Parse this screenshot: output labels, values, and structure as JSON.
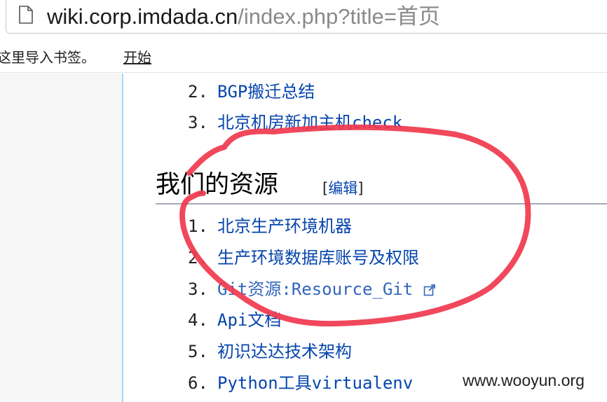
{
  "browser": {
    "url_host": "wiki.corp.imdada.cn",
    "url_path": "/index.php?title=首页",
    "page_icon": "page-icon"
  },
  "bookmarks": {
    "hint_text": "这里导入书签。",
    "start_link": "开始"
  },
  "content": {
    "prev_items": [
      {
        "num": "2.",
        "label": "BGP搬迁总结"
      },
      {
        "num": "3.",
        "label": "北京机房新加主机check"
      }
    ],
    "section": {
      "title": "我们的资源",
      "edit_open": "[",
      "edit_label": "编辑",
      "edit_close": "]"
    },
    "items": [
      {
        "num": "1.",
        "label": "北京生产环境机器",
        "external": false
      },
      {
        "num": "2.",
        "label": "生产环境数据库账号及权限",
        "external": false
      },
      {
        "num": "3.",
        "label": "Git资源:Resource_Git",
        "external": true
      },
      {
        "num": "4.",
        "label": "Api文档",
        "external": false
      },
      {
        "num": "5.",
        "label": "初识达达技术架构",
        "external": false
      },
      {
        "num": "6.",
        "label": "Python工具virtualenv",
        "external": false
      }
    ]
  },
  "annotation": {
    "color": "#f0384e"
  },
  "watermark": "www.wooyun.org"
}
